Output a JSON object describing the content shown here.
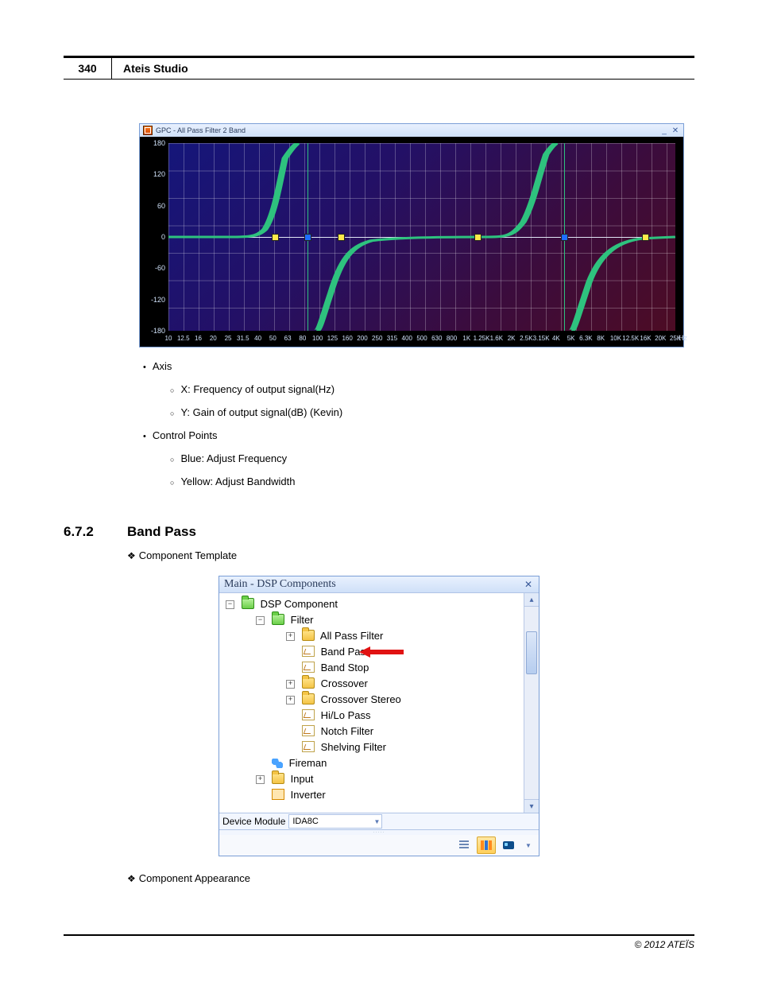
{
  "header": {
    "page_number": "340",
    "title": "Ateis Studio"
  },
  "plot_window": {
    "title": "GPC - All Pass Filter 2 Band",
    "x_unit": "Hz",
    "y_ticks": [
      "180",
      "120",
      "60",
      "0",
      "-60",
      "-120",
      "-180"
    ],
    "x_ticks": [
      "10",
      "12.5",
      "16",
      "20",
      "25",
      "31.5",
      "40",
      "50",
      "63",
      "80",
      "100",
      "125",
      "160",
      "200",
      "250",
      "315",
      "400",
      "500",
      "630",
      "800",
      "1K",
      "1.25K",
      "1.6K",
      "2K",
      "2.5K",
      "3.15K",
      "4K",
      "5K",
      "6.3K",
      "8K",
      "10K",
      "12.5K",
      "16K",
      "20K",
      "25K"
    ]
  },
  "bullets": {
    "l1_1": "Axis",
    "l2_1": "X: Frequency of output signal(Hz)",
    "l2_2": "Y: Gain of output signal(dB) (Kevin)",
    "l1_2": "Control Points",
    "l2_3": "Blue: Adjust Frequency",
    "l2_4": "Yellow: Adjust Bandwidth"
  },
  "section": {
    "number": "6.7.2",
    "title": "Band Pass"
  },
  "diamond1": "Component Template",
  "tree_window": {
    "title": "Main - DSP Components",
    "nodes": {
      "root": "DSP Component",
      "filter": "Filter",
      "allpass": "All Pass Filter",
      "bandpass": "Band Pass",
      "bandstop": "Band Stop",
      "crossover": "Crossover",
      "crossover_stereo": "Crossover Stereo",
      "hilo": "Hi/Lo Pass",
      "notch": "Notch Filter",
      "shelving": "Shelving Filter",
      "fireman": "Fireman",
      "input": "Input",
      "inverter": "Inverter"
    },
    "footer_label": "Device Module",
    "footer_value": "IDA8C"
  },
  "diamond2": "Component Appearance",
  "footer": "© 2012 ATEÏS"
}
